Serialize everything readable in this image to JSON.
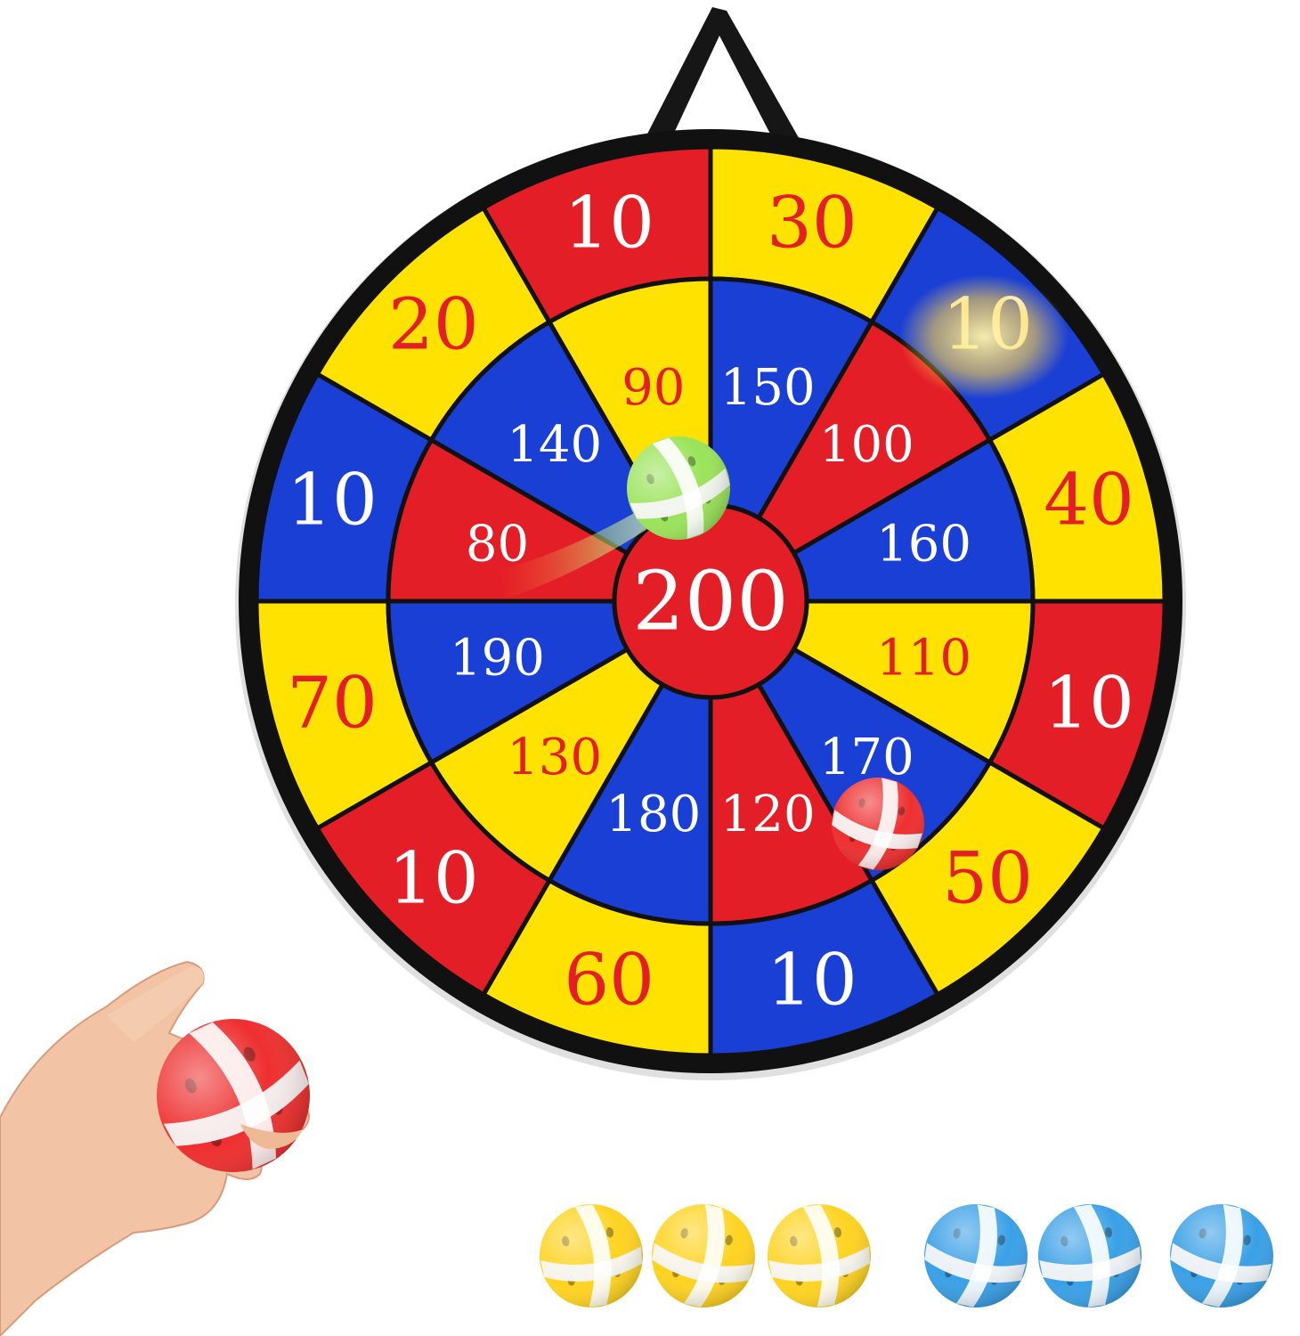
{
  "colors": {
    "red": "#e41e26",
    "yellow": "#ffe200",
    "blue": "#1a3fd4",
    "ring": "#111111",
    "label_on_red_blue": "#ffffff",
    "label_on_yellow": "#e41e26",
    "ball_yellow": "#ffd321",
    "ball_blue": "#3aa0e6",
    "ball_red": "#ee2f2f",
    "ball_green": "#9be35a"
  },
  "dartboard": {
    "bullseye_label": "200",
    "segments": [
      {
        "outer": "30",
        "outer_color": "yellow",
        "inner": "150",
        "inner_color": "blue"
      },
      {
        "outer": "10",
        "outer_color": "blue",
        "inner": "100",
        "inner_color": "red"
      },
      {
        "outer": "40",
        "outer_color": "yellow",
        "inner": "160",
        "inner_color": "blue"
      },
      {
        "outer": "10",
        "outer_color": "red",
        "inner": "110",
        "inner_color": "yellow"
      },
      {
        "outer": "50",
        "outer_color": "yellow",
        "inner": "170",
        "inner_color": "blue"
      },
      {
        "outer": "10",
        "outer_color": "blue",
        "inner": "120",
        "inner_color": "red"
      },
      {
        "outer": "60",
        "outer_color": "yellow",
        "inner": "180",
        "inner_color": "blue"
      },
      {
        "outer": "10",
        "outer_color": "red",
        "inner": "130",
        "inner_color": "yellow"
      },
      {
        "outer": "70",
        "outer_color": "yellow",
        "inner": "190",
        "inner_color": "blue"
      },
      {
        "outer": "10",
        "outer_color": "blue",
        "inner": "80",
        "inner_color": "red"
      },
      {
        "outer": "20",
        "outer_color": "yellow",
        "inner": "140",
        "inner_color": "blue"
      },
      {
        "outer": "10",
        "outer_color": "red",
        "inner": "90",
        "inner_color": "yellow"
      }
    ]
  },
  "balls": {
    "on_board": [
      "green",
      "red"
    ],
    "in_hand": "red",
    "row": [
      "yellow",
      "yellow",
      "yellow",
      "blue",
      "blue",
      "blue"
    ]
  }
}
